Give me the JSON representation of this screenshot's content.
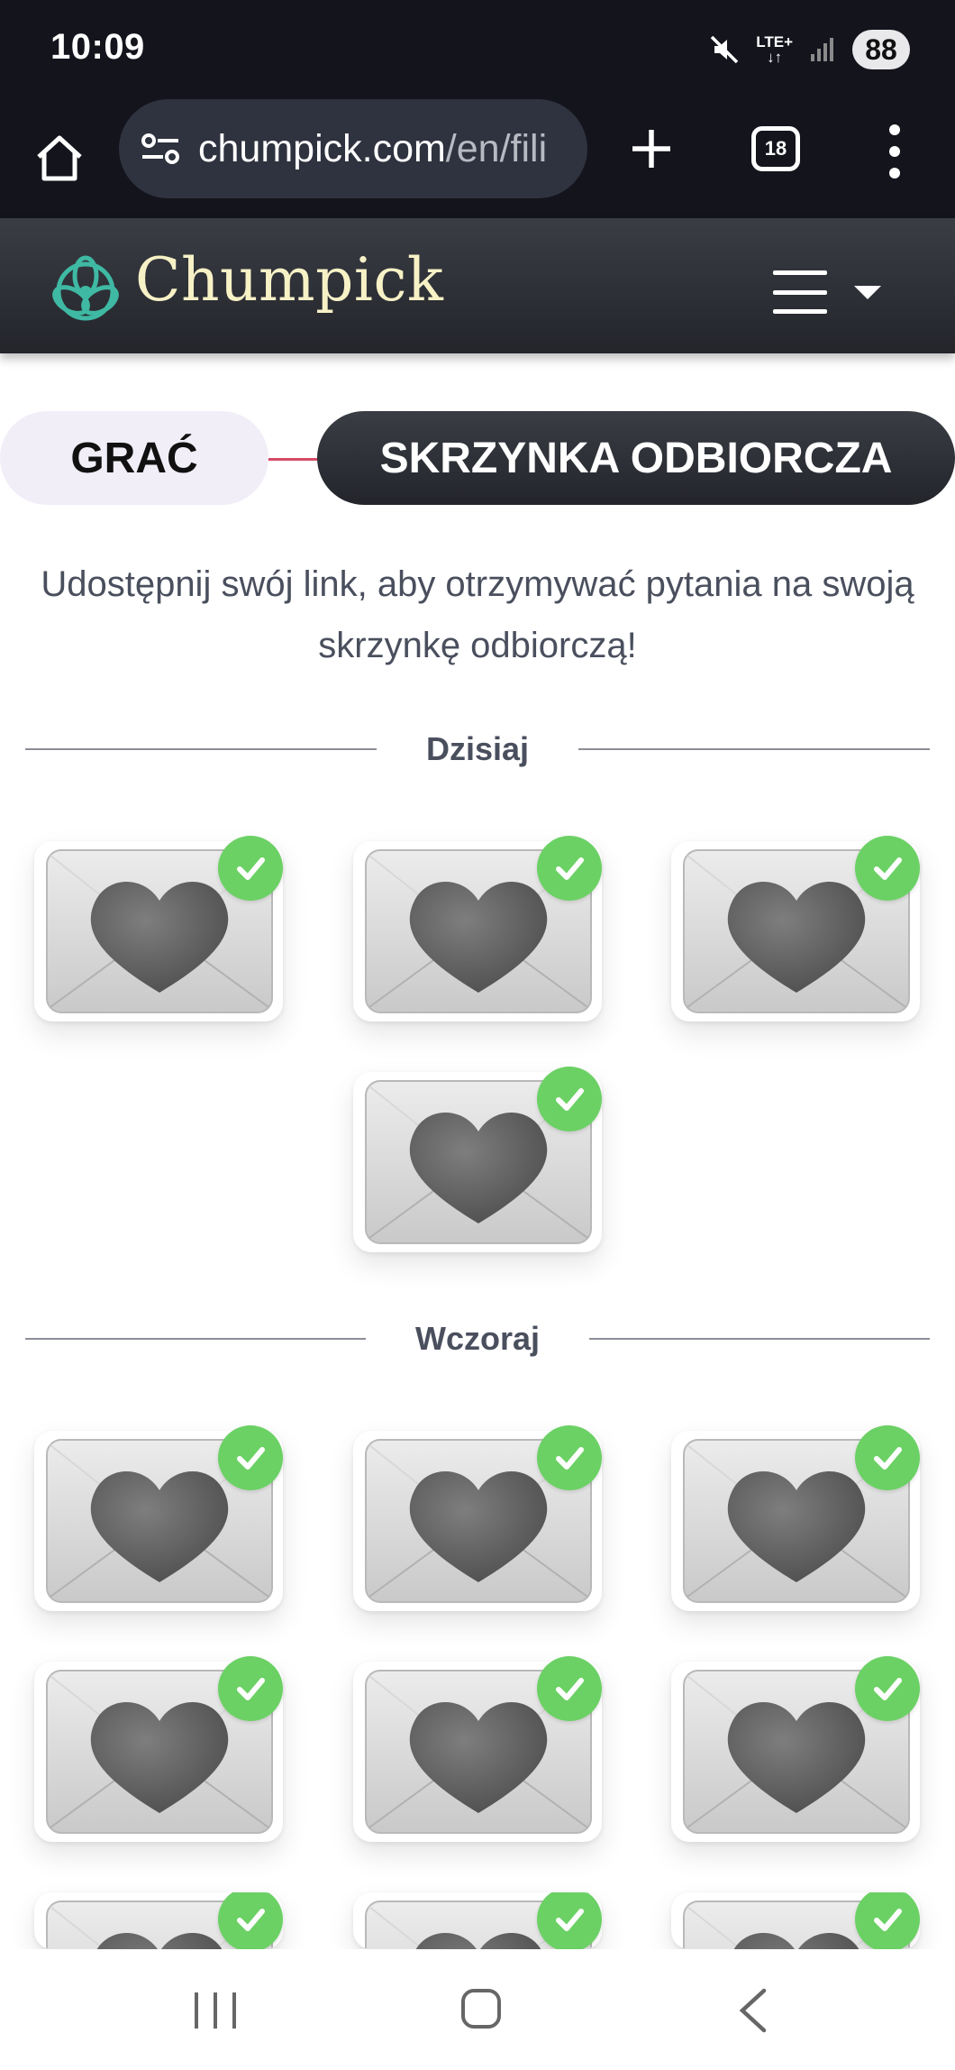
{
  "status_bar": {
    "time": "10:09",
    "network": "LTE+",
    "battery": "88"
  },
  "browser": {
    "url_domain": "chumpick.com",
    "url_path": "/en/fili",
    "tab_count": "18"
  },
  "site": {
    "logo_text": "Chumpick"
  },
  "tabs": {
    "play_label": "GRAĆ",
    "inbox_label": "SKRZYNKA ODBIORCZA"
  },
  "intro_text": "Udostępnij swój link, aby otrzymywać pytania na swoją skrzynkę odbiorczą!",
  "sections": [
    {
      "label": "Dzisiaj",
      "message_count": 4
    },
    {
      "label": "Wczoraj",
      "message_count": 9
    }
  ],
  "colors": {
    "accent_green": "#6bd164",
    "header_dark": "#2a2c33",
    "play_tab_bg": "#f1eef8",
    "connector": "#d64a68",
    "logo_teal": "#3fb9a3",
    "logo_text": "#f7f1c6"
  },
  "icons": {
    "home": "home-icon",
    "site_settings": "site-settings-icon",
    "new_tab": "plus-icon",
    "menu": "more-vert-icon",
    "message": "heart-envelope-icon",
    "read": "check-icon"
  }
}
